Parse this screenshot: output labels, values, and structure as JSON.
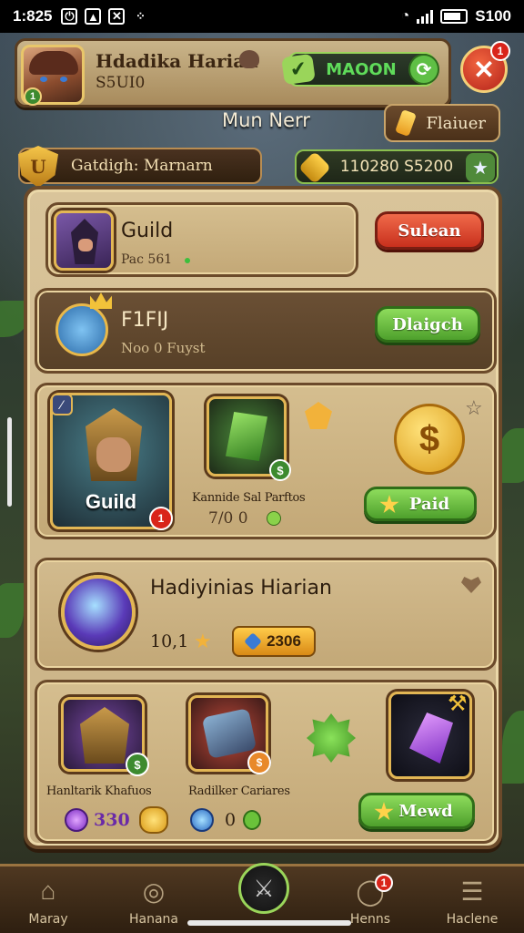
{
  "status_bar": {
    "time": "1:825",
    "right_text": "S100"
  },
  "profile": {
    "name": "Hdadika Harian",
    "sub": "S5UI0",
    "level": "1",
    "mode_label": "MAOON"
  },
  "close_badge": "1",
  "main_title": "Mun Nerr",
  "flame_button": "Flaiuer",
  "guild_tag": "Gatdigh: Marnarn",
  "currency_value": "110280 S5200",
  "guild_card": {
    "title": "Guild",
    "sub": "Pac 561",
    "button": "Sulean"
  },
  "fifu_card": {
    "title": "F1FIJ",
    "sub": "Noo 0 Fuyst",
    "button": "Dlaigch"
  },
  "hero_card": {
    "portrait_label": "Guild",
    "portrait_badge": "1",
    "item_label": "Kannide Sal Parftos",
    "item_value": "7/0 0",
    "button": "Paid"
  },
  "harian_card": {
    "title": "Hadiyinias Hiarian",
    "count": "10,1",
    "badge_value": "2306"
  },
  "bottom_items": {
    "item1_label": "Hanltarik Khafuos",
    "item1_value": "330",
    "item2_label": "Radilker Cariares",
    "item2_value": "0",
    "button": "Mewd"
  },
  "nav": {
    "items": [
      {
        "label": "Maray",
        "icon": "house-icon"
      },
      {
        "label": "Hanana",
        "icon": "search-icon"
      },
      {
        "label": "",
        "icon": "sword-icon"
      },
      {
        "label": "Henns",
        "icon": "chat-icon",
        "badge": "1"
      },
      {
        "label": "Haclene",
        "icon": "barrel-icon"
      }
    ]
  },
  "colors": {
    "panel": "#d9c49a",
    "wood_border": "#6b4a2a",
    "green_button": "#5fb83a",
    "red_button": "#d93e25",
    "gold": "#f2c23a"
  }
}
